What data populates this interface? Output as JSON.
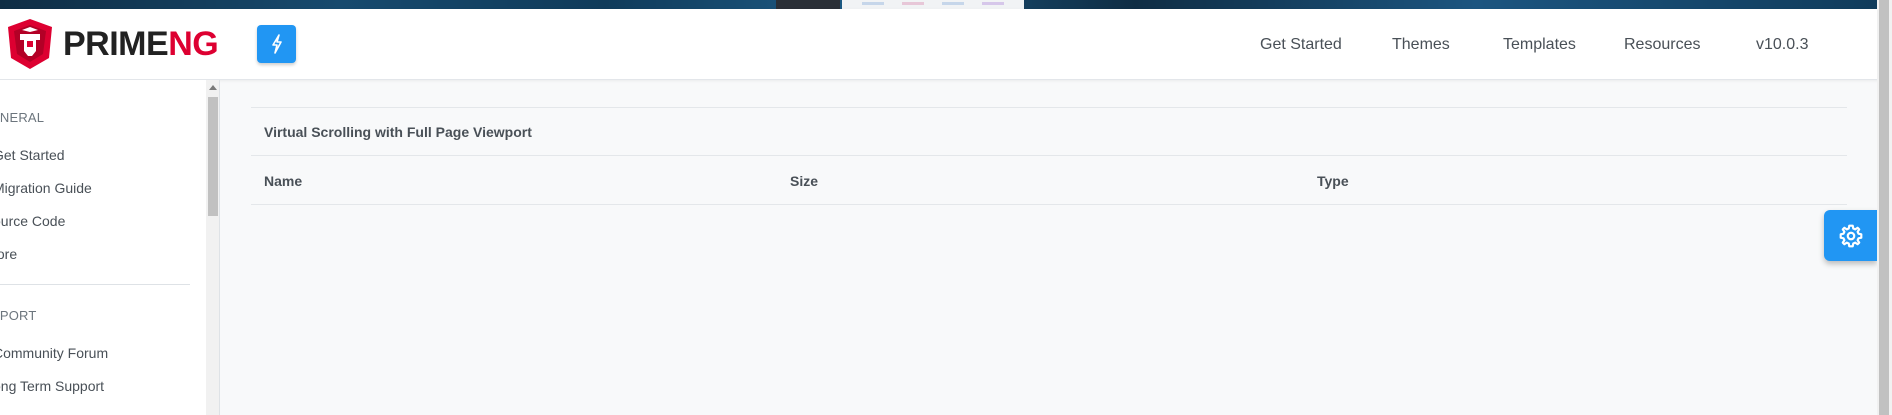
{
  "header": {
    "logo": {
      "prime": "PRIME",
      "ng": "NG"
    },
    "menu_button_icon": "bolt-icon",
    "nav": [
      "Get Started",
      "Themes",
      "Templates",
      "Resources",
      "v10.0.3"
    ]
  },
  "sidebar": {
    "sections": [
      {
        "heading": "ENERAL",
        "items": [
          "Get Started",
          "Migration Guide",
          "ource Code",
          "tore"
        ]
      },
      {
        "heading": "PPORT",
        "items": [
          "Community Forum",
          "ong Term Support"
        ]
      }
    ]
  },
  "main": {
    "table": {
      "title": "Virtual Scrolling with Full Page Viewport",
      "columns": [
        "Name",
        "Size",
        "Type"
      ]
    }
  },
  "config_button_icon": "gear-icon",
  "colors": {
    "accent": "#2196f3",
    "brand_red": "#dd0031",
    "text": "#495057"
  }
}
